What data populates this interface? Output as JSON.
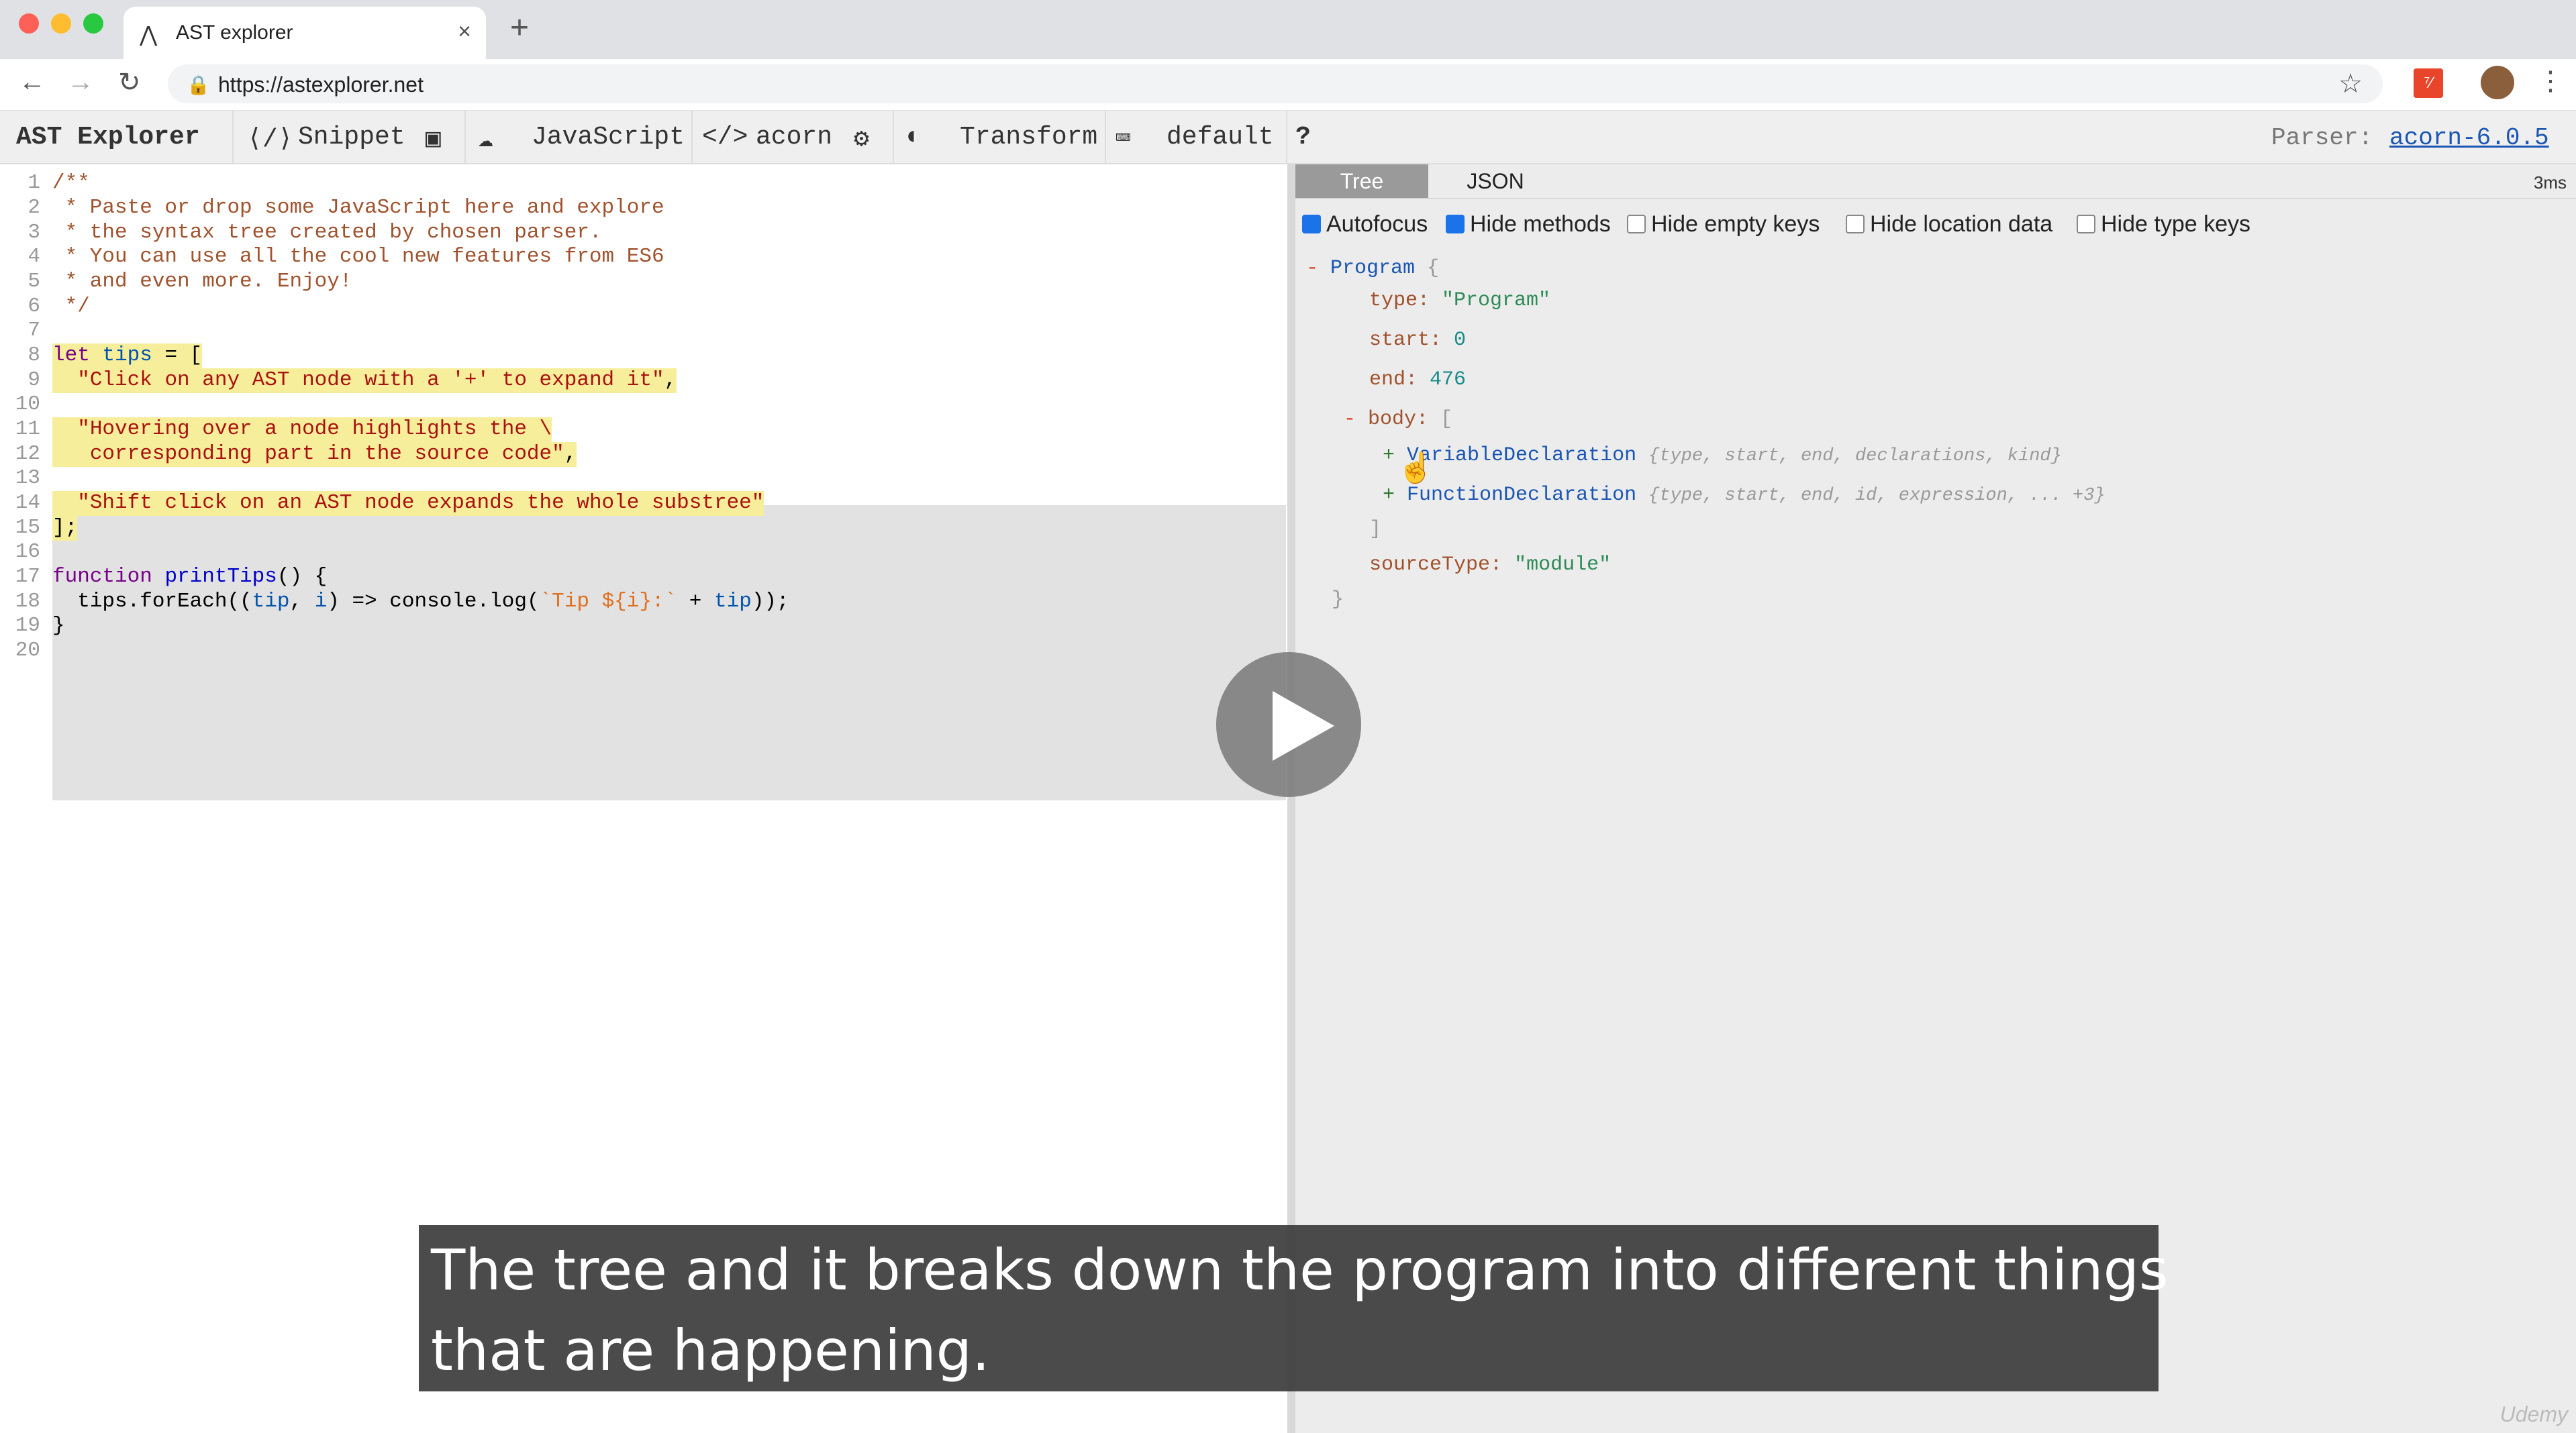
{
  "browser": {
    "tab_title": "AST explorer",
    "new_tab_glyph": "+",
    "url": "https://astexplorer.net",
    "extension_label": "⁷⁄"
  },
  "app_bar": {
    "title": "AST Explorer",
    "snippet": "Snippet",
    "language": "JavaScript",
    "parser": "acorn",
    "transform": "Transform",
    "keymap": "default",
    "help": "?",
    "parser_label": "Parser:",
    "parser_version": "acorn-6.0.5"
  },
  "editor": {
    "lines": [
      {
        "n": "1"
      },
      {
        "n": "2"
      },
      {
        "n": "3"
      },
      {
        "n": "4"
      },
      {
        "n": "5"
      },
      {
        "n": "6"
      },
      {
        "n": "7"
      },
      {
        "n": "8"
      },
      {
        "n": "9"
      },
      {
        "n": "10"
      },
      {
        "n": "11"
      },
      {
        "n": "12"
      },
      {
        "n": "13"
      },
      {
        "n": "14"
      },
      {
        "n": "15"
      },
      {
        "n": "16"
      },
      {
        "n": "17"
      },
      {
        "n": "18"
      },
      {
        "n": "19"
      },
      {
        "n": "20"
      }
    ],
    "c1": "/**",
    "c2": " * Paste or drop some JavaScript here and explore",
    "c3": " * the syntax tree created by chosen parser.",
    "c4": " * You can use all the cool new features from ES6",
    "c5": " * and even more. Enjoy!",
    "c6": " */",
    "l8_kw": "let",
    "l8_var": "tips",
    "l8_rest": " = [",
    "l9": "\"Click on any AST node with a '+' to expand it\"",
    "l9_end": ",",
    "l11": "\"Hovering over a node highlights the \\",
    "l12": " corresponding part in the source code\"",
    "l12_end": ",",
    "l14": "\"Shift click on an AST node expands the whole substree\"",
    "l15": "];",
    "l17_kw": "function",
    "l17_fn": "printTips",
    "l17_rest": "() {",
    "l18_a": "  tips.forEach((",
    "l18_tip": "tip",
    "l18_comma": ", ",
    "l18_i": "i",
    "l18_b": ") => console.log(",
    "l18_tpl": "`Tip ${i}:`",
    "l18_plus": " + ",
    "l18_tip2": "tip",
    "l18_end": "));",
    "l19": "}"
  },
  "tree_panel": {
    "tabs": [
      "Tree",
      "JSON"
    ],
    "timing": "3ms",
    "options": [
      {
        "label": "Autofocus",
        "checked": true
      },
      {
        "label": "Hide methods",
        "checked": true
      },
      {
        "label": "Hide empty keys",
        "checked": false
      },
      {
        "label": "Hide location data",
        "checked": false
      },
      {
        "label": "Hide type keys",
        "checked": false
      }
    ],
    "root_name": "Program",
    "open_brace": "{",
    "close_brace": "}",
    "type_key": "type:",
    "type_val": "\"Program\"",
    "start_key": "start:",
    "start_val": "0",
    "end_key": "end:",
    "end_val": "476",
    "body_key": "body:",
    "open_bracket": "[",
    "close_bracket": "]",
    "node1_name": "VariableDeclaration",
    "node1_summary": "{type, start, end, declarations, kind}",
    "node2_name": "FunctionDeclaration",
    "node2_summary": "{type, start, end, id, expression, ... +3}",
    "source_key": "sourceType:",
    "source_val": "\"module\"",
    "minus": "-",
    "plus": "+"
  },
  "subtitle": {
    "line1": "The tree and it breaks down the program into different things",
    "line2": "that are happening."
  },
  "watermark": "Udemy"
}
